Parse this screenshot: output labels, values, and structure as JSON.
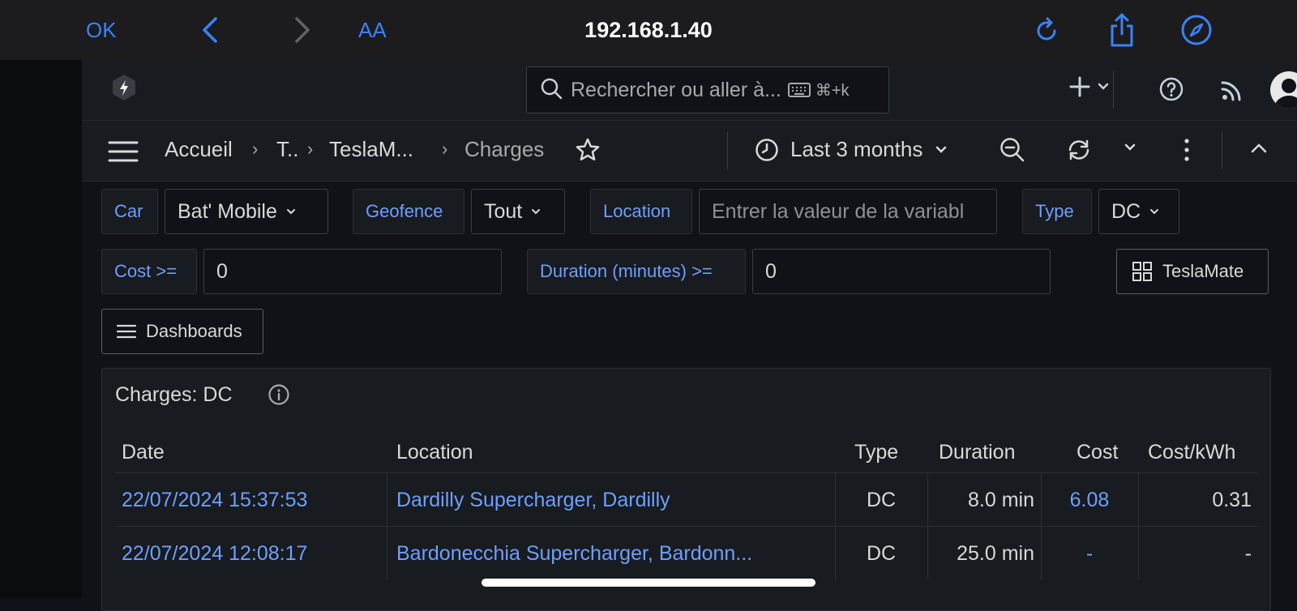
{
  "browser": {
    "ok_label": "OK",
    "text_size_label": "AA",
    "url": "192.168.1.40"
  },
  "topbar": {
    "search_placeholder": "Rechercher ou aller à...",
    "search_shortcut": "⌘+k"
  },
  "breadcrumb": {
    "items": [
      "Accueil",
      "T..",
      "TeslaM...",
      "Charges"
    ]
  },
  "time_range": "Last 3 months",
  "variables": {
    "car": {
      "label": "Car",
      "value": "Bat' Mobile"
    },
    "geofence": {
      "label": "Geofence",
      "value": "Tout"
    },
    "location": {
      "label": "Location",
      "placeholder": "Entrer la valeur de la variabl"
    },
    "type": {
      "label": "Type",
      "value": "DC"
    },
    "cost": {
      "label": "Cost >=",
      "value": "0"
    },
    "duration": {
      "label": "Duration (minutes) >=",
      "value": "0"
    }
  },
  "links": {
    "teslamate": "TeslaMate",
    "dashboards": "Dashboards"
  },
  "panel": {
    "title": "Charges: DC",
    "columns": [
      "Date",
      "Location",
      "Type",
      "Duration",
      "Cost",
      "Cost/kWh"
    ],
    "rows": [
      {
        "date": "22/07/2024 15:37:53",
        "location": "Dardilly Supercharger, Dardilly",
        "type": "DC",
        "duration": "8.0 min",
        "cost": "6.08",
        "cost_kwh": "0.31"
      },
      {
        "date": "22/07/2024 12:08:17",
        "location": "Bardonecchia Supercharger, Bardonn...",
        "type": "DC",
        "duration": "25.0 min",
        "cost": "-",
        "cost_kwh": "-"
      }
    ]
  },
  "colors": {
    "accent": "#6e9fff",
    "ios_blue": "#3b82f6",
    "background": "#111217",
    "panel": "#181b1f"
  }
}
